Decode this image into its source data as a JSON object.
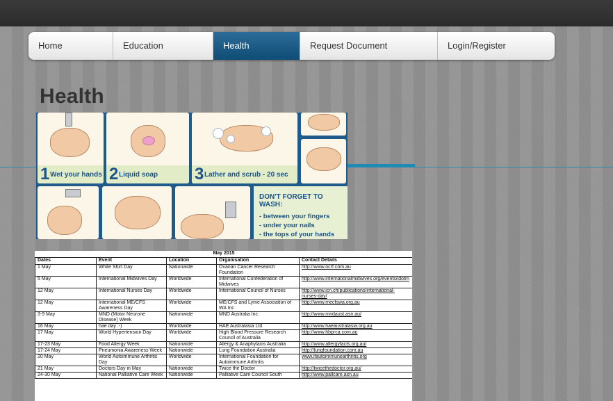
{
  "nav": {
    "items": [
      {
        "label": "Home",
        "active": false
      },
      {
        "label": "Education",
        "active": false
      },
      {
        "label": "Health",
        "active": true
      },
      {
        "label": "Request Document",
        "active": false
      },
      {
        "label": "Login/Register",
        "active": false
      }
    ]
  },
  "page": {
    "title": "Health"
  },
  "handwash": {
    "steps": [
      {
        "num": "1",
        "label": "Wet your hands"
      },
      {
        "num": "2",
        "label": "Liquid soap"
      },
      {
        "num": "3",
        "label": "Lather and scrub - 20 sec"
      }
    ],
    "reminder": {
      "heading": "DON'T FORGET TO WASH:",
      "tips": [
        "- between your fingers",
        "- under your nails",
        "- the tops of your hands"
      ]
    }
  },
  "events_table": {
    "caption": "May 2015",
    "headers": [
      "Dates",
      "Event",
      "Location",
      "Organisation",
      "Contact Details"
    ],
    "rows": [
      [
        "1 May",
        "White Shirt Day",
        "Nationwide",
        "Ovarian Cancer Research Foundation",
        "http://www.ocrf.com.au"
      ],
      [
        "5 May",
        "International Midwives Day",
        "Worldwide",
        "International Confederation of Midwives",
        "http://www.internationalmidwives.org/events/idotm"
      ],
      [
        "12 May",
        "International Nurses Day",
        "Worldwide",
        "International Council of Nurses",
        "http://www.icn.ch/publications/international-nurses-day/"
      ],
      [
        "12 May",
        "International ME/CFS Awareness Day",
        "Worldwide",
        "ME/CFS and Lyme Association of WA Inc",
        "http://www.mecfswa.org.au"
      ],
      [
        "3-9 May",
        "MND (Motor Neurone Disease) Week",
        "Nationwide",
        "MND Australia Inc",
        "http://www.mndaust.asn.au/"
      ],
      [
        "16 May",
        "hae day :-)",
        "Worldwide",
        "HAE Australasia Ltd",
        "http://www.haeaustralasia.org.au"
      ],
      [
        "17 May",
        "World Hypertension Day",
        "Worldwide",
        "High Blood Pressure Research Council of Australia",
        "http://www.hbprca.com.au"
      ],
      [
        "17-23 May",
        "Food Allergy Week",
        "Nationwide",
        "Allergy & Anaphylaxis Australia",
        "http://www.allergyfacts.org.au/"
      ],
      [
        "17-24 May",
        "Pneumonia Awareness Week",
        "Nationwide",
        "Lung Foundation Australia",
        "http://lungfoundation.com.au"
      ],
      [
        "20 May",
        "World Autoimmune Arthritis Day",
        "Worldwide",
        "International Foundation for Autoimmune Arthritis",
        "www.ifautoimmunearthritis.org"
      ],
      [
        "21 May",
        "Doctors Day in May",
        "Nationwide",
        "Twice the Doctor",
        "http://twicethedoctor.org.au/"
      ],
      [
        "24-30 May",
        "National Palliative Care Week",
        "Nationwide",
        "Palliative Care Council South",
        "http://www.pallcare.asn.au"
      ]
    ]
  }
}
